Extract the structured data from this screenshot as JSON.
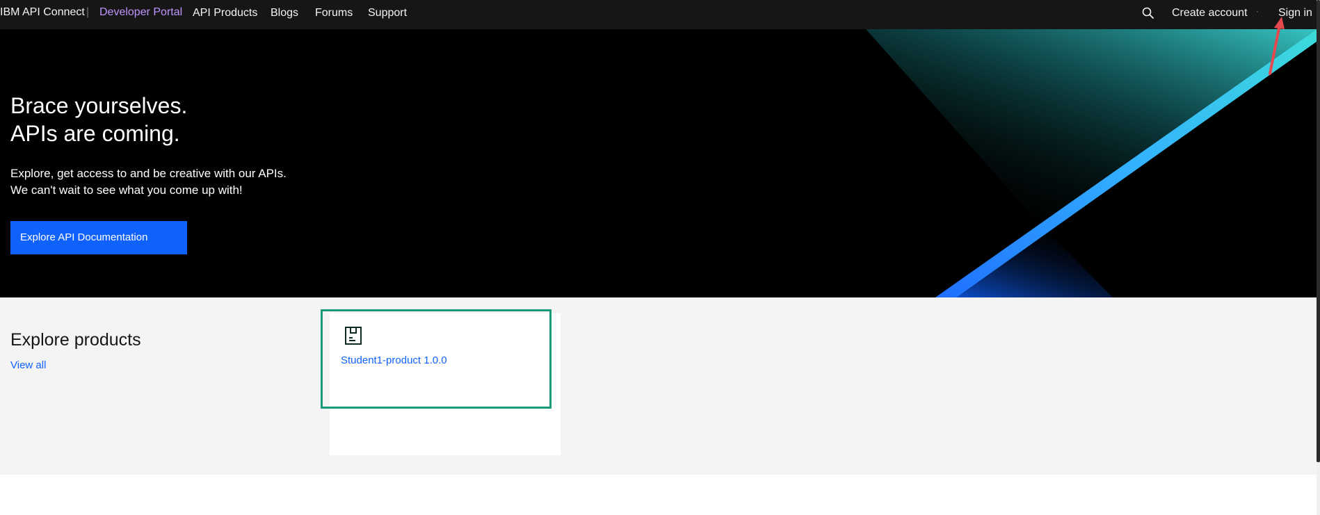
{
  "nav": {
    "brand": "IBM API Connect",
    "separator": "|",
    "portal": "Developer Portal",
    "links": [
      "API Products",
      "Blogs",
      "Forums",
      "Support"
    ],
    "search_icon": "search-icon",
    "create_account": "Create account",
    "dot": "·",
    "sign_in": "Sign in"
  },
  "hero": {
    "title_line1": "Brace yourselves.",
    "title_line2": "APIs are coming.",
    "desc_line1": "Explore, get access to and be creative with our APIs.",
    "desc_line2": "We can't wait to see what you come up with!",
    "cta": "Explore API Documentation"
  },
  "products": {
    "heading": "Explore products",
    "view_all": "View all",
    "items": [
      {
        "icon": "product-icon",
        "title": "Student1-product 1.0.0"
      }
    ]
  },
  "colors": {
    "nav_bg": "#161616",
    "portal_accent": "#be95ff",
    "primary_blue": "#0f62fe",
    "highlight_green": "#1a9a7a",
    "annotation_red": "#e5484d"
  }
}
